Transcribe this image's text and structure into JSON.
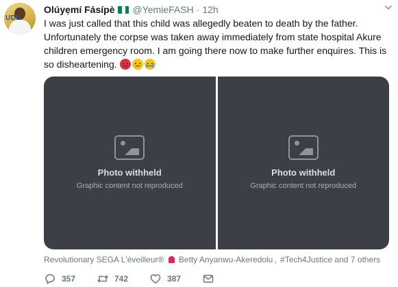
{
  "tweet": {
    "author": {
      "name": "Olúyẹmí Fásípè",
      "handle": "@YemieFASH",
      "time": "12h",
      "avatar_text": "UDE",
      "flag_colors": [
        "#008751",
        "#ffffff",
        "#008751"
      ]
    },
    "text": "I was just called that this child was allegedly beaten to death by the father. Unfortunately the corpse was taken away immediately from state hospital Akure children emergency room. I am going there now to make further enquires. This is so disheartening.",
    "emojis": [
      "angry-face",
      "sad-face",
      "crying-face"
    ],
    "media": {
      "count": 2
    },
    "tagged": {
      "user1": "Revolutionary SEGA L'éveilleur®",
      "user2": "Betty Anyanwu-Akeredolu",
      "user3": "#Tech4Justice",
      "others": "and 7 others"
    },
    "actions": {
      "replies": "357",
      "retweets": "742",
      "likes": "387"
    }
  },
  "placeholder": {
    "label": "Photo withheld",
    "sub": "Graphic content not reproduced"
  },
  "colors": {
    "name": "#14171a",
    "meta": "#657786",
    "link": "#1da1f2"
  }
}
